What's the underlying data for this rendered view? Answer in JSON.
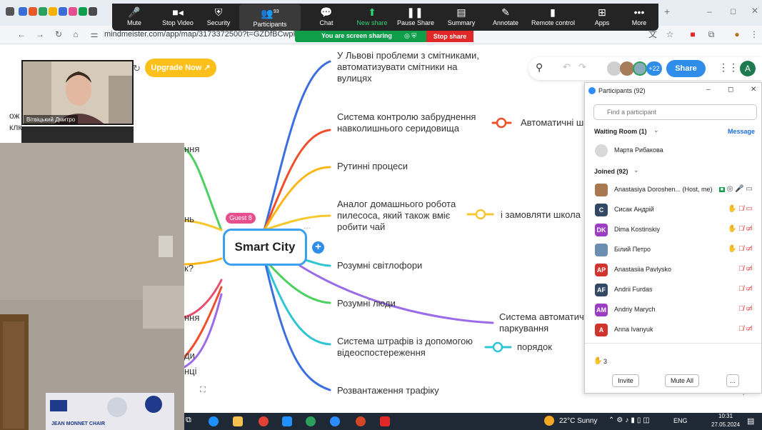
{
  "browser": {
    "url": "mindmeister.com/app/map/3173372500?t=GZDfBCwpPF"
  },
  "zoom_toolbar": {
    "items": [
      {
        "label": "Mute",
        "icon": "mic-icon"
      },
      {
        "label": "Stop Video",
        "icon": "video-icon"
      },
      {
        "label": "Security",
        "icon": "shield-icon"
      },
      {
        "label": "Participants",
        "icon": "people-icon",
        "count": "93"
      },
      {
        "label": "Chat",
        "icon": "chat-icon"
      },
      {
        "label": "New share",
        "icon": "share-up-icon"
      },
      {
        "label": "Pause Share",
        "icon": "pause-icon"
      },
      {
        "label": "Summary",
        "icon": "summary-icon"
      },
      {
        "label": "Annotate",
        "icon": "pen-icon"
      },
      {
        "label": "Remote control",
        "icon": "mouse-icon"
      },
      {
        "label": "Apps",
        "icon": "apps-icon"
      },
      {
        "label": "More",
        "icon": "more-icon"
      }
    ],
    "sharing_text": "You are screen sharing",
    "stop_share": "Stop share"
  },
  "mindmap": {
    "upgrade_label": "Upgrade Now ↗",
    "center": "Smart City",
    "guest_badge": "Guest 8",
    "share_label": "Share",
    "collab_count": "+22",
    "avatar_letter": "A",
    "topics": [
      "У Львові проблеми з смітниками,\nавтоматизувати смітники на\nвулицях",
      "Система контролю забруднення\nнавколишнього сеpидовища",
      "Рутинні процеси",
      "Аналог домашнього робота\nпилесоса, який також вміє\nробити чай",
      "Розумні світлофори",
      "Розумні люди",
      "Система штрафів із допомогою\nвідеоспостереження",
      "Розвантаження трафіку"
    ],
    "subtopics": [
      "Автоматичні ш",
      "і замовляти школа",
      "Система автоматич\nпаркування",
      "порядок"
    ],
    "left_fragments": [
      "ння",
      "нь",
      "к?",
      "ння",
      "ди",
      "нці"
    ]
  },
  "participants_panel": {
    "title": "Participants (92)",
    "search_placeholder": "Find a participant",
    "waiting_room_label": "Waiting Room (1)",
    "message_label": "Message",
    "waiting": [
      {
        "name": "Марта Рибакова"
      }
    ],
    "joined_label": "Joined (92)",
    "joined": [
      {
        "name": "Anastasiya Doroshen... (Host, me)",
        "initials": "",
        "color": "#a87850",
        "hand": false
      },
      {
        "name": "Сисак Андрій",
        "initials": "C",
        "color": "#334a66",
        "hand": true
      },
      {
        "name": "Dima Kostinskiy",
        "initials": "DK",
        "color": "#9d3cc4",
        "hand": true
      },
      {
        "name": "Білий Петро",
        "initials": "",
        "color": "#6a8fb0",
        "hand": true
      },
      {
        "name": "Anastasiia Pavlysko",
        "initials": "AP",
        "color": "#d0342c",
        "hand": false
      },
      {
        "name": "Andrii Furdas",
        "initials": "AF",
        "color": "#334a66",
        "hand": false
      },
      {
        "name": "Andriy Marych",
        "initials": "AM",
        "color": "#9d3cc4",
        "hand": false
      },
      {
        "name": "Anna Ivanyuk",
        "initials": "A",
        "color": "#d0342c",
        "hand": false
      }
    ],
    "raised_hands": "3",
    "invite_label": "Invite",
    "mute_all_label": "Mute All",
    "more_label": "..."
  },
  "webcam": {
    "name": "Вітвіцький Дмитро"
  },
  "room_sign": "JEAN MONNET CHAIR",
  "taskbar": {
    "weather": "22°C  Sunny",
    "lang": "ENG",
    "time": "10:31",
    "date": "27.05.2024"
  },
  "left_edge_text": [
    "ож",
    "клк"
  ]
}
